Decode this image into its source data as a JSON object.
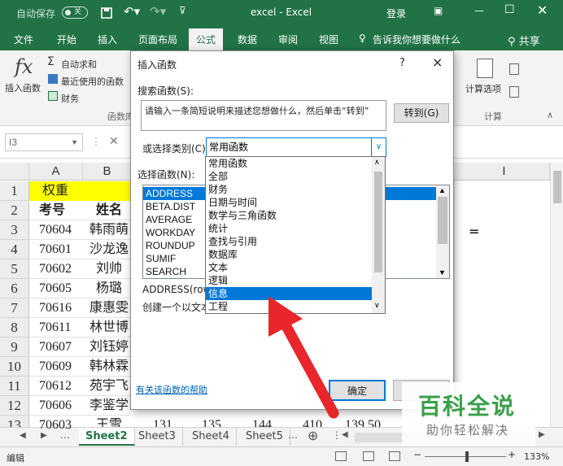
{
  "titlebar": {
    "autosave": "自动保存",
    "toggle": "关",
    "title": "excel  -  Excel",
    "login": "登录",
    "bg": "#217346"
  },
  "tabs": [
    "文件",
    "开始",
    "插入",
    "页面布局",
    "公式",
    "数据",
    "审阅",
    "视图"
  ],
  "active_tab": "公式",
  "tell_me": "告诉我你想要做什么",
  "share": "共享",
  "ribbon": {
    "insert_function": "插入函数",
    "fx": "fx",
    "autosum": "自动求和",
    "recent": "最近使用的函数",
    "finance": "财务",
    "group_label": "函数库",
    "calc_options": "计算选项",
    "calc_group": "计算"
  },
  "formula_bar": {
    "name_box": "I3"
  },
  "grid": {
    "col_a": "A",
    "col_b": "B",
    "col_i": "I",
    "rows": [
      {
        "n": "1",
        "a": "权重",
        "b": ""
      },
      {
        "n": "2",
        "a": "考号",
        "b": "姓名"
      },
      {
        "n": "3",
        "a": "70604",
        "b": "韩雨萌"
      },
      {
        "n": "4",
        "a": "70601",
        "b": "沙龙逸"
      },
      {
        "n": "5",
        "a": "70602",
        "b": "刘帅"
      },
      {
        "n": "6",
        "a": "70605",
        "b": "杨璐"
      },
      {
        "n": "7",
        "a": "70616",
        "b": "康惠雯"
      },
      {
        "n": "8",
        "a": "70611",
        "b": "林世博"
      },
      {
        "n": "9",
        "a": "70607",
        "b": "刘钰婷"
      },
      {
        "n": "10",
        "a": "70609",
        "b": "韩林霖"
      },
      {
        "n": "11",
        "a": "70612",
        "b": "苑宇飞"
      },
      {
        "n": "12",
        "a": "70606",
        "b": "李鉴学"
      },
      {
        "n": "13",
        "a": "70603",
        "b": "王雪"
      }
    ],
    "row13_extra": [
      "131",
      "135",
      "144",
      "410",
      "139.50"
    ],
    "eq_text": "="
  },
  "sheets": [
    "Sheet2",
    "Sheet3",
    "Sheet4",
    "Sheet5"
  ],
  "active_sheet": "Sheet2",
  "status": {
    "mode": "编辑",
    "zoom": "133%"
  },
  "dialog": {
    "title": "插入函数",
    "help": "?",
    "close": "×",
    "search_label": "搜索函数(S):",
    "search_text": "请输入一条简短说明来描述您想做什么，然后单击“转到”",
    "goto": "转到(G)",
    "category_label": "或选择类别(C):",
    "category_value": "常用函数",
    "select_label": "选择函数(N):",
    "functions": [
      "ADDRESS",
      "BETA.DIST",
      "AVERAGE",
      "WORKDAY",
      "ROUNDUP",
      "SUMIF",
      "SEARCH"
    ],
    "signature": "ADDRESS(row",
    "description": "创建一个以文本",
    "help_link": "有关该函数的帮助",
    "ok": "确定",
    "categories": [
      "常用函数",
      "全部",
      "财务",
      "日期与时间",
      "数学与三角函数",
      "统计",
      "查找与引用",
      "数据库",
      "文本",
      "逻辑",
      "信息",
      "工程"
    ],
    "selected_category": "信息"
  },
  "watermark": {
    "title": "百科全说",
    "subtitle": "助你轻松解决"
  },
  "colors": {
    "excel_green": "#217346",
    "highlight_yellow": "#ffff00",
    "select_blue": "#0078d7",
    "arrow_red": "#e8262b"
  }
}
